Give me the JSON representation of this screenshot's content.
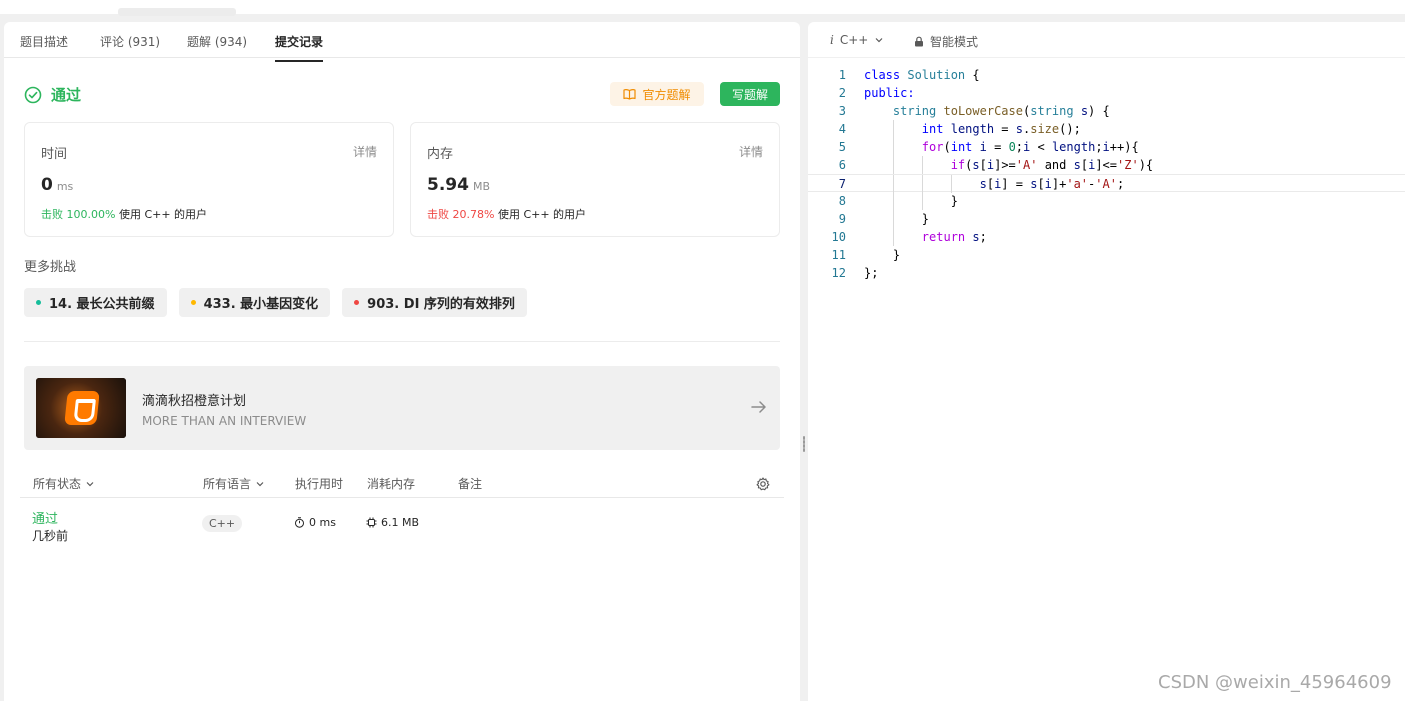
{
  "tabs": [
    "题目描述",
    "评论 (931)",
    "题解 (934)",
    "提交记录"
  ],
  "result": {
    "status": "通过",
    "official_solution": "官方题解",
    "write_solution": "写题解"
  },
  "runtime_card": {
    "label": "时间",
    "detail": "详情",
    "value": "0",
    "unit": "ms",
    "beat_prefix": "击败",
    "beat_pct": "100.00%",
    "beat_suffix": "使用 C++ 的用户"
  },
  "memory_card": {
    "label": "内存",
    "detail": "详情",
    "value": "5.94",
    "unit": "MB",
    "beat_prefix": "击败",
    "beat_pct": "20.78%",
    "beat_suffix": "使用 C++ 的用户"
  },
  "more_challenges": {
    "title": "更多挑战",
    "items": [
      {
        "label": "14. 最长公共前缀",
        "color": "#15bd9a"
      },
      {
        "label": "433. 最小基因变化",
        "color": "#ffb800"
      },
      {
        "label": "903. DI 序列的有效排列",
        "color": "#ef4743"
      }
    ]
  },
  "banner": {
    "title": "滴滴秋招橙意计划",
    "subtitle": "MORE THAN AN INTERVIEW"
  },
  "table": {
    "headers": [
      "所有状态",
      "所有语言",
      "执行用时",
      "消耗内存",
      "备注"
    ],
    "rows": [
      {
        "status": "通过",
        "time_ago": "几秒前",
        "lang": "C++",
        "runtime": "0 ms",
        "memory": "6.1 MB"
      }
    ]
  },
  "editor": {
    "language": "C++",
    "mode": "智能模式",
    "line_numbers": [
      "1",
      "2",
      "3",
      "4",
      "5",
      "6",
      "7",
      "8",
      "9",
      "10",
      "11",
      "12"
    ],
    "tokens": {
      "class": "class",
      "Solution": "Solution",
      "public": "public:",
      "string": "string",
      "toLowerCase": "toLowerCase",
      "int": "int",
      "length": "length",
      "size": "size",
      "for": "for",
      "i": "i",
      "zero": "0",
      "if": "if",
      "A": "'A'",
      "and": "and",
      "Z": "'Z'",
      "a": "'a'",
      "return": "return",
      "s": "s"
    }
  },
  "watermark": "CSDN @weixin_45964609",
  "colors": {
    "accent_green": "#2db55d",
    "accent_orange": "#f08c00",
    "danger_red": "#ef4743"
  }
}
